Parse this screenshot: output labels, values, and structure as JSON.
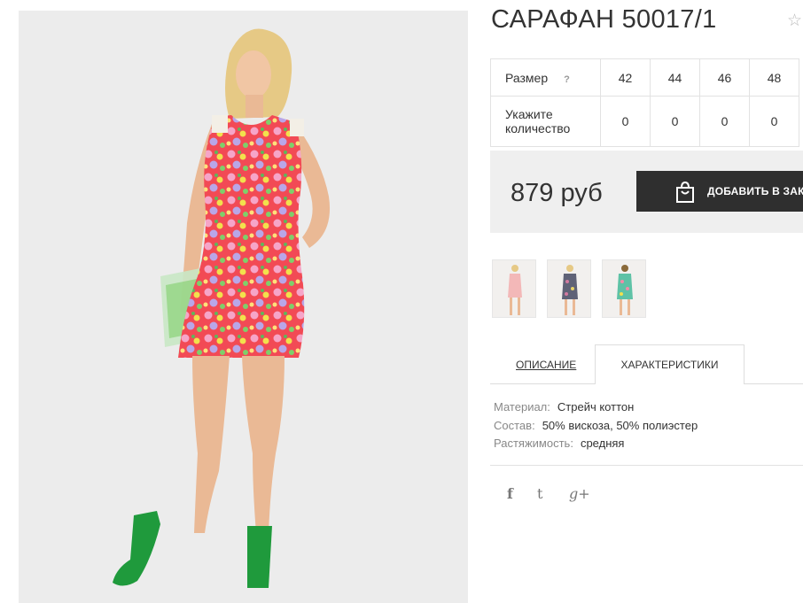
{
  "product": {
    "title": "САРАФАН 50017/1",
    "favorite_icon": "star-outline-icon"
  },
  "sizes": {
    "size_label": "Размер",
    "hint": "?",
    "quantity_label": "Укажите количество",
    "options": [
      {
        "size": "42",
        "quantity": "0"
      },
      {
        "size": "44",
        "quantity": "0"
      },
      {
        "size": "46",
        "quantity": "0"
      },
      {
        "size": "48",
        "quantity": "0"
      }
    ]
  },
  "price": {
    "value": "879 руб",
    "add_to_cart": "ДОБАВИТЬ В ЗАК",
    "cart_icon": "shopping-bag-icon"
  },
  "thumbnails": [
    "pink-dress-thumbnail",
    "grey-floral-dress-thumbnail",
    "mint-floral-dress-thumbnail"
  ],
  "tabs": {
    "description": "ОПИСАНИЕ",
    "characteristics": "ХАРАКТЕРИСТИКИ"
  },
  "specs": [
    {
      "key": "Материал:",
      "value": "Стрейч коттон"
    },
    {
      "key": "Состав:",
      "value": "50% вискоза, 50% полиэстер"
    },
    {
      "key": "Растяжимость:",
      "value": "средняя"
    }
  ],
  "social": {
    "facebook": "f",
    "twitter": "t",
    "google_plus": "g+"
  },
  "colors": {
    "button_bg": "#2f2f2f",
    "price_box_bg": "#efefef",
    "dress_red": "#f24a55",
    "shoes_green": "#1f9a3c"
  }
}
